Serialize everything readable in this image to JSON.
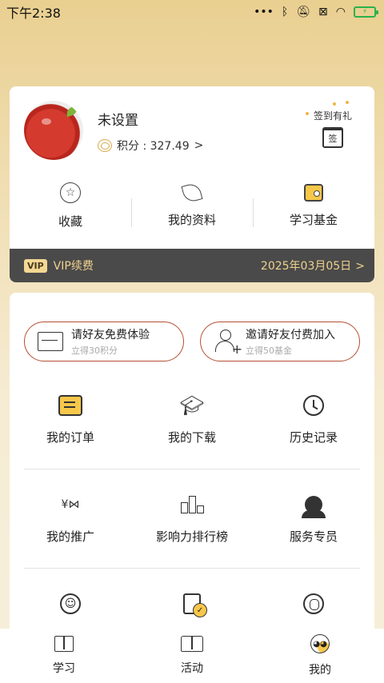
{
  "status_bar": {
    "time": "下午2:38",
    "icons": [
      "dots-icon",
      "bluetooth-icon",
      "mute-icon",
      "sim-off-icon",
      "wifi-icon",
      "battery-icon"
    ]
  },
  "profile": {
    "username": "未设置",
    "points_label": "积分 : 327.49",
    "points_chevron": ">",
    "checkin_label": "签到有礼",
    "checkin_icon_text": "签"
  },
  "quick_actions": [
    {
      "label": "收藏",
      "icon": "star-icon"
    },
    {
      "label": "我的资料",
      "icon": "leaf-icon"
    },
    {
      "label": "学习基金",
      "icon": "wallet-icon"
    }
  ],
  "vip": {
    "badge": "VIP",
    "label": "VIP续费",
    "date": "2025年03月05日",
    "chevron": ">"
  },
  "invite": [
    {
      "title": "请好友免费体验",
      "sub": "立得30积分",
      "icon": "mail-icon"
    },
    {
      "title": "邀请好友付费加入",
      "sub": "立得50基金",
      "icon": "user-add-icon"
    }
  ],
  "grid_row1": [
    {
      "label": "我的订单",
      "icon": "order-icon"
    },
    {
      "label": "我的下载",
      "icon": "graduation-cap-icon"
    },
    {
      "label": "历史记录",
      "icon": "clock-icon"
    }
  ],
  "grid_row2": [
    {
      "label": "我的推广",
      "icon": "share-icon"
    },
    {
      "label": "影响力排行榜",
      "icon": "ranking-icon"
    },
    {
      "label": "服务专员",
      "icon": "agent-icon"
    }
  ],
  "grid_row3": [
    {
      "label": "",
      "icon": "smile-icon"
    },
    {
      "label": "",
      "icon": "document-check-icon"
    },
    {
      "label": "",
      "icon": "coin-icon"
    }
  ],
  "tabs": [
    {
      "label": "学习",
      "icon": "book-icon"
    },
    {
      "label": "活动",
      "icon": "open-book-icon"
    },
    {
      "label": "我的",
      "icon": "me-icon"
    }
  ],
  "colors": {
    "gold": "#e9cf90",
    "vip_text": "#f0d28f",
    "accent_yellow": "#f7c74a",
    "invite_border": "#b54f34"
  }
}
